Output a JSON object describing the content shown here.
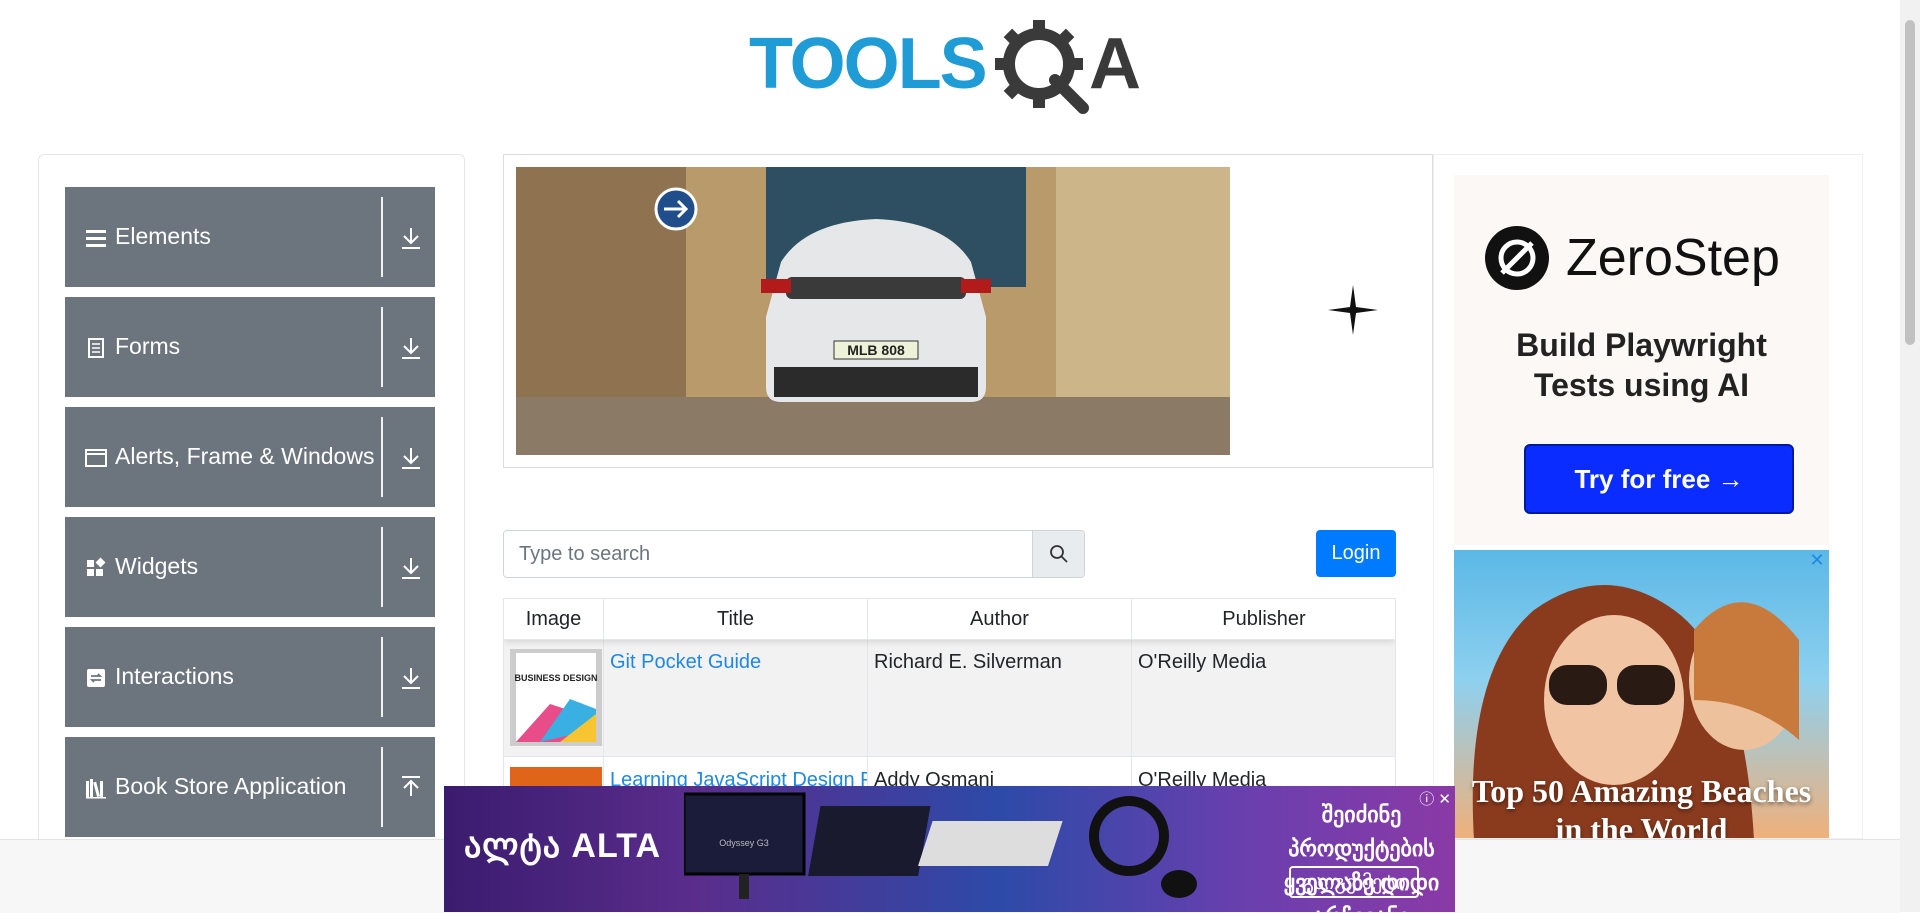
{
  "logo": {
    "text": "TOOLSQA"
  },
  "menu": {
    "groups": [
      {
        "label": "Elements",
        "icon": "list-icon",
        "arrow": "down"
      },
      {
        "label": "Forms",
        "icon": "document-icon",
        "arrow": "down"
      },
      {
        "label": "Alerts, Frame & Windows",
        "icon": "window-icon",
        "arrow": "down"
      },
      {
        "label": "Widgets",
        "icon": "widgets-icon",
        "arrow": "down"
      },
      {
        "label": "Interactions",
        "icon": "interactions-icon",
        "arrow": "down"
      },
      {
        "label": "Book Store Application",
        "icon": "library-icon",
        "arrow": "up"
      }
    ]
  },
  "search": {
    "placeholder": "Type to search"
  },
  "login": {
    "label": "Login"
  },
  "table": {
    "headers": [
      "Image",
      "Title",
      "Author",
      "Publisher"
    ],
    "rows": [
      {
        "title": "Git Pocket Guide",
        "author": "Richard E. Silverman",
        "publisher": "O'Reilly Media",
        "cover_text": "BUSINESS DESIGN"
      },
      {
        "title": "Learning JavaScript Design Pa",
        "author": "Addy Osmani",
        "publisher": "O'Reilly Media"
      }
    ]
  },
  "ad_right": {
    "brand": "ZeroStep",
    "tagline_1": "Build Playwright",
    "tagline_2": "Tests using AI",
    "cta": "Try for free →",
    "beach_1": "Top 50 Amazing Beaches",
    "beach_2": "in the World"
  },
  "ad_bottom": {
    "brand": "ALTA",
    "brand_prefix": "ალტა",
    "headline_1": "შეიძინე პროდუქტების",
    "headline_2": "ყველაზე დიდი არჩევანი",
    "cta": "გაიგე მეტი",
    "screen_text": "Odyssey G3"
  },
  "car": {
    "plate": "MLB 808"
  },
  "colors": {
    "menu_bg": "#6c757d",
    "login_bg": "#007bff",
    "link": "#1e88e5",
    "zs_button": "#0a2cff"
  }
}
